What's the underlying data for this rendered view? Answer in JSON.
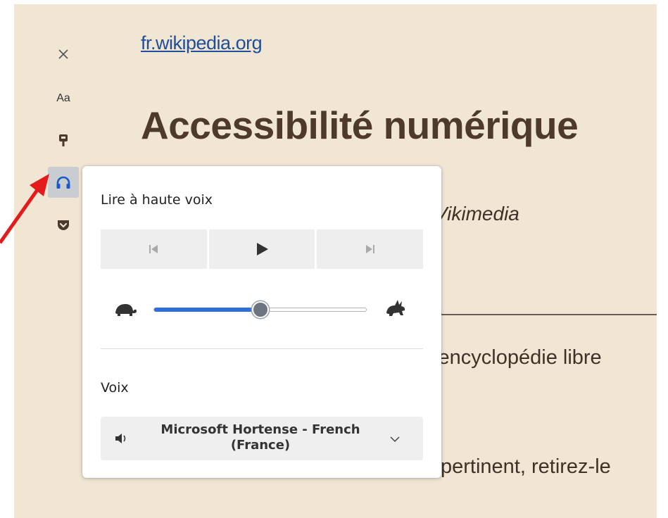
{
  "reader": {
    "site_link": "fr.wikipedia.org",
    "title": "Accessibilité numérique",
    "fragment_vikimedia": "Vikimedia",
    "fragment_encyclopedie": "'encyclopédie libre",
    "fragment_pertinent": "pertinent, retirez-le"
  },
  "toolbar": {
    "items": [
      {
        "name": "close",
        "icon": "close-icon"
      },
      {
        "name": "type",
        "label": "Aa",
        "icon": "text-icon"
      },
      {
        "name": "theme",
        "icon": "brush-icon"
      },
      {
        "name": "read-aloud",
        "icon": "headphones-icon",
        "active": true
      },
      {
        "name": "pocket",
        "icon": "pocket-icon"
      }
    ]
  },
  "read_aloud": {
    "title": "Lire à haute voix",
    "controls": [
      "previous-icon",
      "play-icon",
      "next-icon"
    ],
    "speed": {
      "min_icon": "turtle-icon",
      "max_icon": "rabbit-icon",
      "level": 0.5
    },
    "voice_label": "Voix",
    "voice_value_line1": "Microsoft Hortense - French",
    "voice_value_line2": "(France)"
  },
  "colors": {
    "reader_background": "#f1e6d4",
    "accent": "#2f6fdc",
    "arrow": "#e31b1b"
  }
}
